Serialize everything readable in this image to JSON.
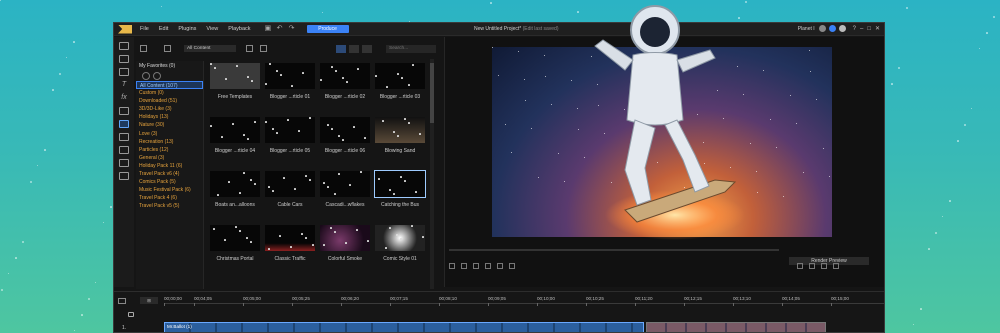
{
  "menu": [
    "File",
    "Edit",
    "Plugins",
    "View",
    "Playback"
  ],
  "toolbar": {
    "produce_label": "Produce"
  },
  "project": {
    "title": "New Untitled Project*",
    "saved": "(Edit last saved)"
  },
  "user": {
    "name": "Planet I"
  },
  "library": {
    "dropdown": "All Content",
    "search_placeholder": "Search...",
    "favorites_label": "My Favorites (0)",
    "categories": [
      "All Content (107)",
      "Custom (0)",
      "Downloaded (51)",
      "3D/3D-Like (3)",
      "Holidays (13)",
      "Nature (30)",
      "Love (3)",
      "Recreation (13)",
      "Particles (12)",
      "General (3)",
      "Holiday Pack 11 (6)",
      "Travel Pack v6 (4)",
      "Comics Pack (5)",
      "Music Festival Pack (6)",
      "Travel Pack 4 (6)",
      "Travel Pack v5 (5)"
    ],
    "tiles": [
      "Free Templates",
      "Blogger ...rticle 01",
      "Blogger ...rticle 02",
      "Blogger ...rticle 03",
      "Blogger ...rticle 04",
      "Blogger ...rticle 05",
      "Blogger ...rticle 06",
      "Blowing Sand",
      "Boats an...alloons",
      "Cable Cars",
      "Cascadi...wflakes",
      "Catching the Bus",
      "Christmas Portal",
      "Classic Traffic",
      "Colorful Smoke",
      "Comic Style 01"
    ]
  },
  "preview": {
    "render_label": "Render Preview"
  },
  "timeline": {
    "fit_label": "⊞",
    "ticks": [
      "00;00;00",
      "00;04;05",
      "00;05;00",
      "00;05;25",
      "00;06;20",
      "00;07;15",
      "00;08;10",
      "00;09;05",
      "00;10;00",
      "00;10;25",
      "00;11;20",
      "00;12;15",
      "00;13;10",
      "00;14;05",
      "00;15;00"
    ],
    "track_number": "1.",
    "clip_name": "Mr.Ballot (1)"
  },
  "colors": {
    "accent": "#3b82f6",
    "category_text": "#e6a33d"
  }
}
